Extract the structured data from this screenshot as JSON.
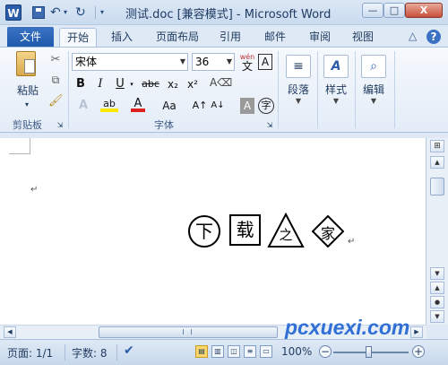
{
  "titlebar": {
    "app_icon": "W",
    "title": "测试.doc [兼容模式] - Microsoft Word",
    "minimize": "—",
    "maximize": "□",
    "close": "X"
  },
  "quick_access": {
    "undo": "↶",
    "undo_arrow": "▾",
    "redo": "↻",
    "customize": "▾"
  },
  "tabs": [
    {
      "label": "文件"
    },
    {
      "label": "开始"
    },
    {
      "label": "插入"
    },
    {
      "label": "页面布局"
    },
    {
      "label": "引用"
    },
    {
      "label": "邮件"
    },
    {
      "label": "审阅"
    },
    {
      "label": "视图"
    }
  ],
  "tab_right": {
    "collapse": "△",
    "help": "?"
  },
  "ribbon": {
    "clipboard": {
      "label": "剪贴板",
      "paste": "粘贴",
      "launcher": "⇲"
    },
    "font": {
      "label": "字体",
      "font_name": "宋体",
      "font_size": "36",
      "bold": "B",
      "italic": "I",
      "underline": "U",
      "strikethrough": "abc",
      "subscript": "x₂",
      "superscript": "x²",
      "grow": "A↑",
      "shrink": "A↓",
      "case": "Aa",
      "phonetic": "wén",
      "border_char": "A",
      "launcher": "⇲"
    },
    "paragraph": {
      "label": "段落"
    },
    "styles": {
      "label": "样式"
    },
    "editing": {
      "label": "编辑"
    }
  },
  "document": {
    "enclosed_chars": [
      {
        "char": "下",
        "shape": "circle"
      },
      {
        "char": "载",
        "shape": "square"
      },
      {
        "char": "之",
        "shape": "triangle"
      },
      {
        "char": "家",
        "shape": "diamond"
      }
    ],
    "para_mark": "↵"
  },
  "watermark": "pcxuexi.com",
  "statusbar": {
    "page": "页面: 1/1",
    "words": "字数: 8",
    "zoom": "100%",
    "zoom_level_percent": 100,
    "zoom_minus": "−",
    "zoom_plus": "+"
  }
}
